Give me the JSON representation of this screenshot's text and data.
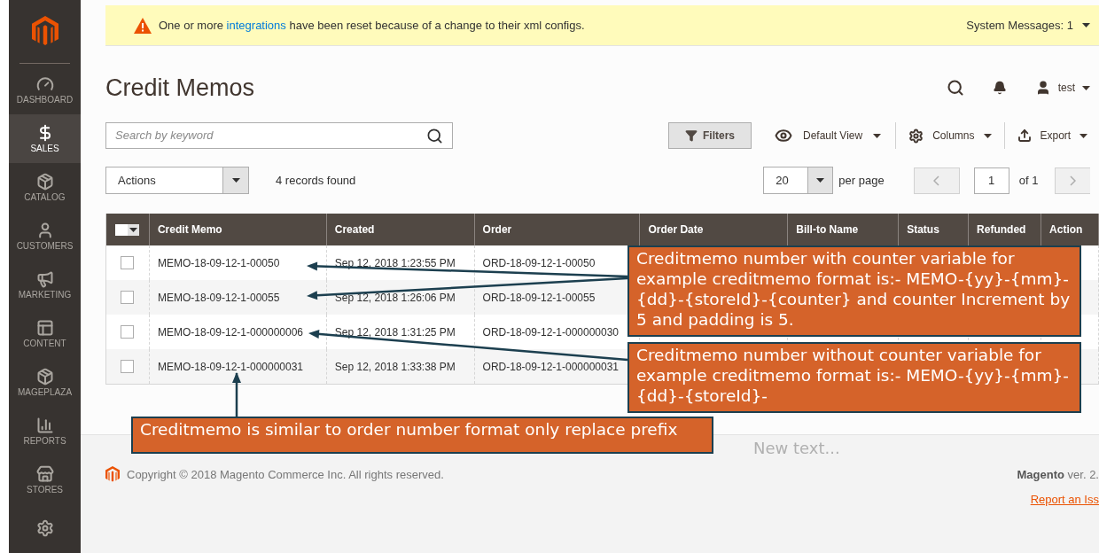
{
  "system_message": {
    "text_before": "One or more",
    "link": "integrations",
    "text_after": "have been reset because of a change to their xml configs.",
    "counter": "System Messages: 1"
  },
  "sidebar": {
    "items": [
      {
        "label": "DASHBOARD",
        "selected": false
      },
      {
        "label": "SALES",
        "selected": true
      },
      {
        "label": "CATALOG",
        "selected": false
      },
      {
        "label": "CUSTOMERS",
        "selected": false
      },
      {
        "label": "MARKETING",
        "selected": false
      },
      {
        "label": "CONTENT",
        "selected": false
      },
      {
        "label": "MAGEPLAZA",
        "selected": false
      },
      {
        "label": "REPORTS",
        "selected": false
      },
      {
        "label": "STORES",
        "selected": false
      },
      {
        "selected": false
      }
    ]
  },
  "page_title": "Credit Memos",
  "header": {
    "user": "test"
  },
  "search": {
    "placeholder": "Search by keyword"
  },
  "toolbar": {
    "filters": "Filters",
    "view": "Default View",
    "columns": "Columns",
    "export": "Export"
  },
  "actions": {
    "label": "Actions"
  },
  "records": "4 records found",
  "per_page": {
    "value": "20",
    "label": "per page"
  },
  "pagination": {
    "page": "1",
    "total": "of 1"
  },
  "table": {
    "select_all": {
      "checked": false
    },
    "columns": [
      "Credit Memo",
      "Created",
      "Order",
      "Order Date",
      "Bill-to Name",
      "Status",
      "Refunded",
      "Action"
    ],
    "rows": [
      {
        "checked": false,
        "cells": [
          "MEMO-18-09-12-1-00050",
          "Sep 12, 2018 1:23:55 PM",
          "ORD-18-09-12-1-00050"
        ]
      },
      {
        "checked": false,
        "cells": [
          "MEMO-18-09-12-1-00055",
          "Sep 12, 2018 1:26:06 PM",
          "ORD-18-09-12-1-00055"
        ]
      },
      {
        "checked": false,
        "cells": [
          "MEMO-18-09-12-1-000000006",
          "Sep 12, 2018 1:31:25 PM",
          "ORD-18-09-12-1-000000030"
        ]
      },
      {
        "checked": false,
        "cells": [
          "MEMO-18-09-12-1-000000031",
          "Sep 12, 2018 1:33:38 PM",
          "ORD-18-09-12-1-000000031"
        ]
      }
    ]
  },
  "annotations": [
    {
      "kind": "callout",
      "text": "Creditmemo number with counter variable for example creditmemo format is:- MEMO-{yy}-{mm}-{dd}-{storeId}-{counter} and counter Increment by 5 and padding is 5."
    },
    {
      "kind": "callout",
      "text": "Creditmemo number without counter variable for example creditmemo format is:- MEMO-{yy}-{mm}-{dd}-{storeId}-"
    },
    {
      "kind": "callout",
      "text": "Creditmemo is similar to order number format only replace prefix"
    },
    {
      "kind": "faint",
      "text": "New text..."
    }
  ],
  "footer": {
    "copyright": "Copyright © 2018 Magento Commerce Inc. All rights reserved.",
    "brand": "Magento",
    "version": "ver. 2.",
    "link": "Report an Iss"
  }
}
